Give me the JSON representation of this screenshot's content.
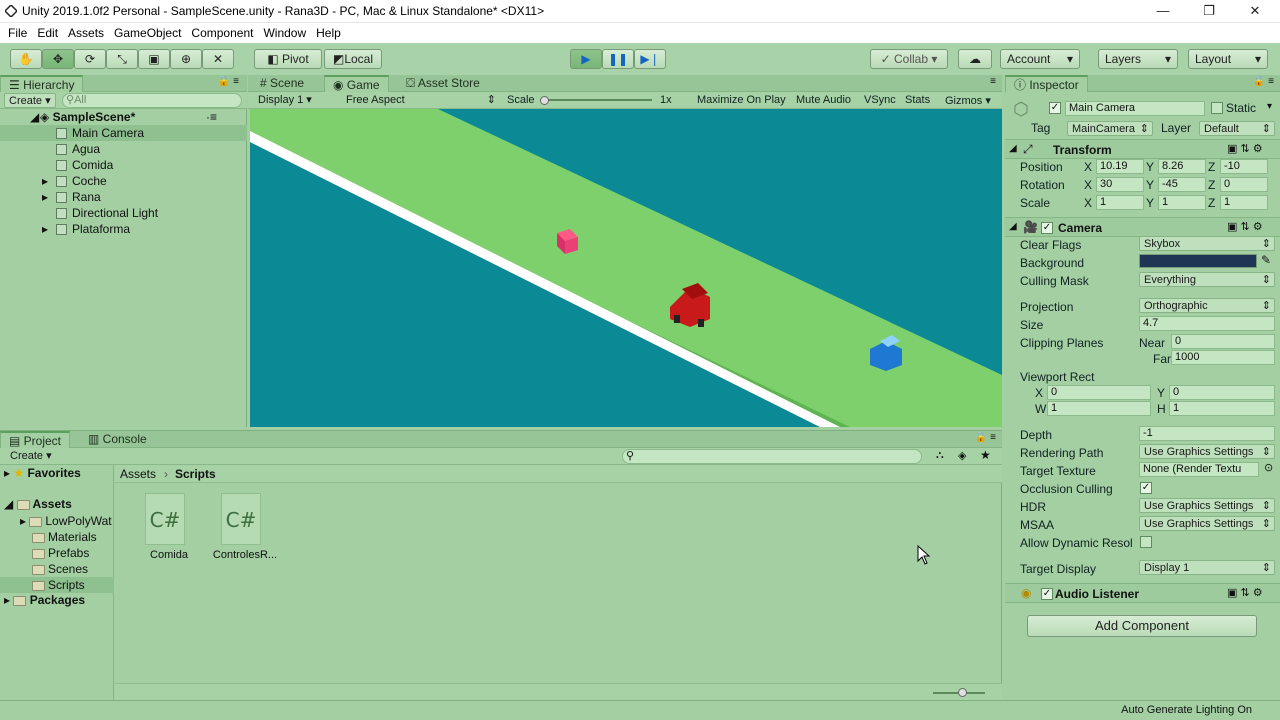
{
  "window": {
    "title": "Unity 2019.1.0f2 Personal - SampleScene.unity - Rana3D - PC, Mac & Linux Standalone* <DX11>",
    "min_glyph": "—",
    "max_glyph": "❐",
    "close_glyph": "✕"
  },
  "menu": [
    "File",
    "Edit",
    "Assets",
    "GameObject",
    "Component",
    "Window",
    "Help"
  ],
  "toolbar": {
    "pivot": "Pivot",
    "local": "Local",
    "collab": "Collab",
    "account": "Account",
    "layers": "Layers",
    "layout": "Layout"
  },
  "hierarchy": {
    "tab": "Hierarchy",
    "create": "Create",
    "search_placeholder": "All",
    "scene": "SampleScene*",
    "items": [
      {
        "label": "Main Camera",
        "selected": true,
        "arrow": false
      },
      {
        "label": "Agua",
        "arrow": false
      },
      {
        "label": "Comida",
        "arrow": false
      },
      {
        "label": "Coche",
        "arrow": true
      },
      {
        "label": "Rana",
        "arrow": true
      },
      {
        "label": "Directional Light",
        "arrow": false
      },
      {
        "label": "Plataforma",
        "arrow": true
      }
    ]
  },
  "game": {
    "tabs": [
      "Scene",
      "Game",
      "Asset Store"
    ],
    "display": "Display 1",
    "aspect": "Free Aspect",
    "scale_label": "Scale",
    "scale_value": "1x",
    "options": [
      "Maximize On Play",
      "Mute Audio",
      "VSync",
      "Stats",
      "Gizmos"
    ],
    "colors": {
      "water": "#0b8a96",
      "road": "#7ed06c",
      "edge": "#ffffff"
    }
  },
  "project": {
    "tabs": [
      "Project",
      "Console"
    ],
    "create": "Create",
    "favorites": "Favorites",
    "assets": "Assets",
    "packages": "Packages",
    "folders": [
      "LowPolyWat",
      "Materials",
      "Prefabs",
      "Scenes",
      "Scripts"
    ],
    "breadcrumb": [
      "Assets",
      "Scripts"
    ],
    "files": [
      {
        "icon": "C#",
        "name": "Comida"
      },
      {
        "icon": "C#",
        "name": "ControlesR..."
      }
    ]
  },
  "inspector": {
    "tab": "Inspector",
    "object_name": "Main Camera",
    "static_label": "Static",
    "tag_label": "Tag",
    "tag": "MainCamera",
    "layer_label": "Layer",
    "layer": "Default",
    "transform": {
      "title": "Transform",
      "rows": [
        {
          "label": "Position",
          "x": "10.19",
          "y": "8.26",
          "z": "-10"
        },
        {
          "label": "Rotation",
          "x": "30",
          "y": "-45",
          "z": "0"
        },
        {
          "label": "Scale",
          "x": "1",
          "y": "1",
          "z": "1"
        }
      ]
    },
    "camera": {
      "title": "Camera",
      "clear_flags": {
        "label": "Clear Flags",
        "value": "Skybox"
      },
      "background": {
        "label": "Background",
        "color": "#1f3554"
      },
      "culling_mask": {
        "label": "Culling Mask",
        "value": "Everything"
      },
      "projection": {
        "label": "Projection",
        "value": "Orthographic"
      },
      "size": {
        "label": "Size",
        "value": "4.7"
      },
      "clipping": {
        "label": "Clipping Planes",
        "near_label": "Near",
        "near": "0",
        "far_label": "Far",
        "far": "1000"
      },
      "viewport": {
        "label": "Viewport Rect",
        "x": "0",
        "y": "0",
        "w": "1",
        "h": "1"
      },
      "depth": {
        "label": "Depth",
        "value": "-1"
      },
      "rendering_path": {
        "label": "Rendering Path",
        "value": "Use Graphics Settings"
      },
      "target_texture": {
        "label": "Target Texture",
        "value": "None (Render Textu"
      },
      "occlusion": {
        "label": "Occlusion Culling"
      },
      "hdr": {
        "label": "HDR",
        "value": "Use Graphics Settings"
      },
      "msaa": {
        "label": "MSAA",
        "value": "Use Graphics Settings"
      },
      "dynamic": {
        "label": "Allow Dynamic Resol"
      },
      "target_display": {
        "label": "Target Display",
        "value": "Display 1"
      }
    },
    "audio_listener": "Audio Listener",
    "add_component": "Add Component"
  },
  "status": "Auto Generate Lighting On"
}
